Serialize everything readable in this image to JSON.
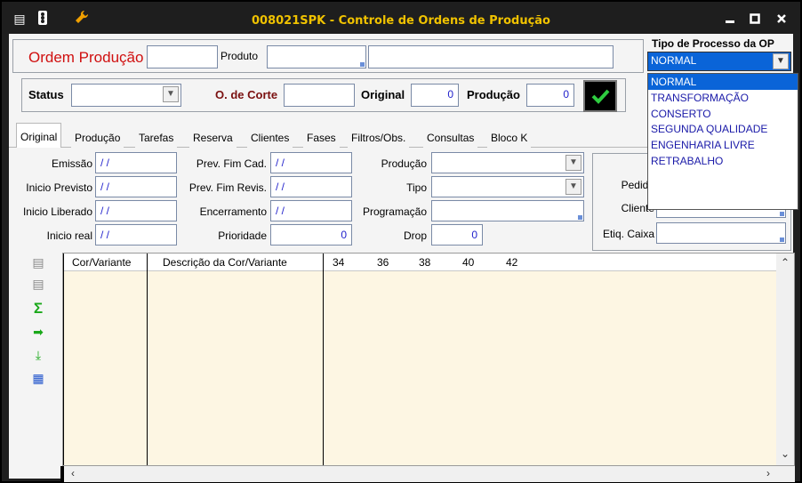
{
  "window": {
    "title": "008021SPK - Controle de Ordens de Produção",
    "minimize": "▬",
    "maximize": "▣",
    "close": "✕"
  },
  "header": {
    "ordem_label": "Ordem Produção",
    "produto_label": "Produto",
    "status_label": "Status",
    "corte_label": "O. de Corte",
    "original_label": "Original",
    "original_value": "0",
    "producao_label": "Produção",
    "producao_value": "0"
  },
  "tipo_processo": {
    "label": "Tipo de Processo da OP",
    "selected": "NORMAL",
    "options": [
      "NORMAL",
      "TRANSFORMAÇÃO",
      "CONSERTO",
      "SEGUNDA QUALIDADE",
      "ENGENHARIA LIVRE",
      "RETRABALHO"
    ]
  },
  "tabs": [
    "Original",
    "Produção",
    "Tarefas",
    "Reserva",
    "Clientes",
    "Fases",
    "Filtros/Obs.",
    "Consultas",
    "Bloco K"
  ],
  "form": {
    "emissao_label": "Emissão",
    "emissao_value": "/ /",
    "inicio_previsto_label": "Inicio Previsto",
    "inicio_previsto_value": "/ /",
    "inicio_liberado_label": "Inicio Liberado",
    "inicio_liberado_value": "/ /",
    "inicio_real_label": "Inicio real",
    "inicio_real_value": "/ /",
    "prev_fim_cad_label": "Prev. Fim Cad.",
    "prev_fim_cad_value": "/ /",
    "prev_fim_revis_label": "Prev. Fim Revis.",
    "prev_fim_revis_value": "/ /",
    "encerramento_label": "Encerramento",
    "encerramento_value": "/ /",
    "prioridade_label": "Prioridade",
    "prioridade_value": "0",
    "producao_label": "Produção",
    "tipo_label": "Tipo",
    "programacao_label": "Programação",
    "drop_label": "Drop",
    "drop_value": "0",
    "pedido_label": "Pedido",
    "cliente_label": "Cliente",
    "etiq_caixa_label": "Etiq. Caixa"
  },
  "grid": {
    "columns": [
      "Cor/Variante",
      "Descrição da Cor/Variante",
      "34",
      "36",
      "38",
      "40",
      "42"
    ]
  },
  "colors": {
    "title_text": "#f0c200",
    "grid_bg": "#fdf6e3",
    "dropdown_selected": "#0a64d8",
    "red_label": "#d01010"
  }
}
